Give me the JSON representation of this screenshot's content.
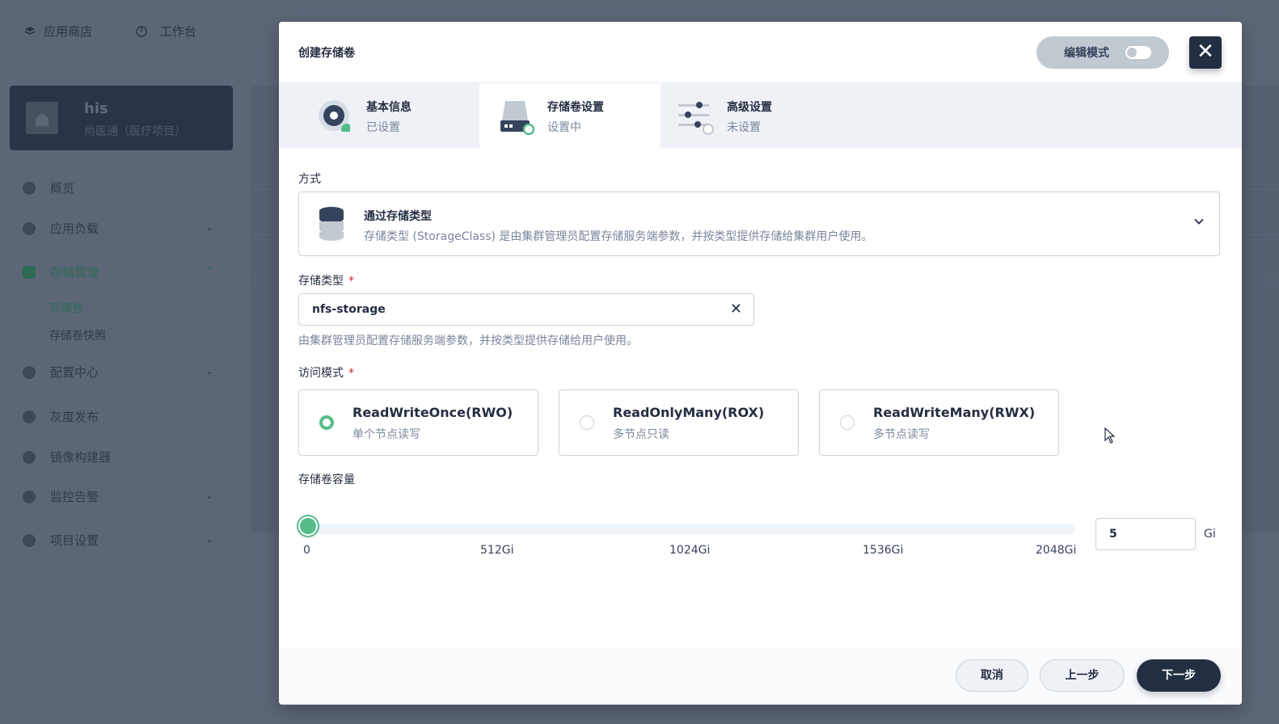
{
  "background": {
    "top_nav": [
      "应用商店",
      "工作台"
    ],
    "project": {
      "name": "his",
      "description": "尚医通（医疗项目）"
    },
    "sidebar": [
      {
        "label": "概览",
        "chevron": ""
      },
      {
        "label": "应用负载",
        "chevron": "⌄"
      },
      {
        "label": "存储管理",
        "chevron": "⌃"
      },
      {
        "label": "配置中心",
        "chevron": "⌄"
      },
      {
        "label": "灰度发布",
        "chevron": ""
      },
      {
        "label": "镜像构建器",
        "chevron": ""
      },
      {
        "label": "监控告警",
        "chevron": "⌄"
      },
      {
        "label": "项目设置",
        "chevron": "⌄"
      }
    ],
    "sidebar_sub": [
      "存储卷",
      "存储卷快照"
    ]
  },
  "modal": {
    "title": "创建存储卷",
    "edit_mode_label": "编辑模式",
    "close_glyph": "✕",
    "steps": [
      {
        "label": "基本信息",
        "status": "已设置"
      },
      {
        "label": "存储卷设置",
        "status": "设置中"
      },
      {
        "label": "高级设置",
        "status": "未设置"
      }
    ],
    "method": {
      "label": "方式",
      "title": "通过存储类型",
      "description": "存储类型 (StorageClass) 是由集群管理员配置存储服务端参数，并按类型提供存储给集群用户使用。"
    },
    "storage_class": {
      "label": "存储类型",
      "required_mark": "*",
      "value": "nfs-storage",
      "clear_glyph": "✕",
      "hint": "由集群管理员配置存储服务端参数，并按类型提供存储给用户使用。"
    },
    "access_mode": {
      "label": "访问模式",
      "required_mark": "*",
      "selected": 0,
      "options": [
        {
          "title": "ReadWriteOnce(RWO)",
          "subtitle": "单个节点读写"
        },
        {
          "title": "ReadOnlyMany(ROX)",
          "subtitle": "多节点只读"
        },
        {
          "title": "ReadWriteMany(RWX)",
          "subtitle": "多节点读写"
        }
      ]
    },
    "capacity": {
      "label": "存储卷容量",
      "value": "5",
      "unit": "Gi",
      "ticks": [
        "0",
        "512Gi",
        "1024Gi",
        "1536Gi",
        "2048Gi"
      ],
      "max": 2048
    },
    "footer": {
      "cancel": "取消",
      "previous": "上一步",
      "next": "下一步"
    }
  },
  "colors": {
    "accent": "#55bc8a",
    "dark": "#242e42",
    "muted": "#79879c",
    "required": "#ca2621"
  }
}
